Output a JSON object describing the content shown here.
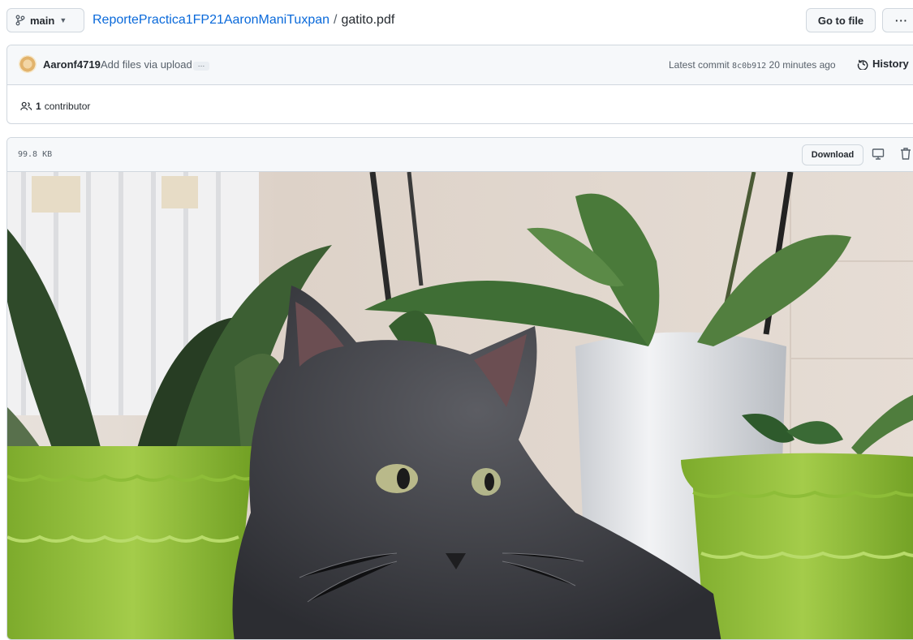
{
  "header": {
    "branch": "main",
    "repo": "ReportePractica1FP21AaronManiTuxpan",
    "separator": "/",
    "file": "gatito.pdf",
    "go_to_file": "Go to file",
    "more": "···"
  },
  "commit": {
    "author": "Aaronf4719",
    "message": "Add files via upload",
    "ellipsis": "…",
    "latest_prefix": "Latest commit",
    "sha": "8c0b912",
    "time": "20 minutes ago",
    "history": "History"
  },
  "contributors": {
    "count": "1",
    "label": "contributor"
  },
  "file": {
    "size": "99.8 KB",
    "download": "Download"
  },
  "icons": [
    "branch-icon",
    "chevron-down-icon",
    "history-icon",
    "people-icon",
    "desktop-icon",
    "trash-icon"
  ],
  "colors": {
    "link": "#0969da",
    "border": "#d0d7de",
    "header_bg": "#f6f8fa"
  }
}
